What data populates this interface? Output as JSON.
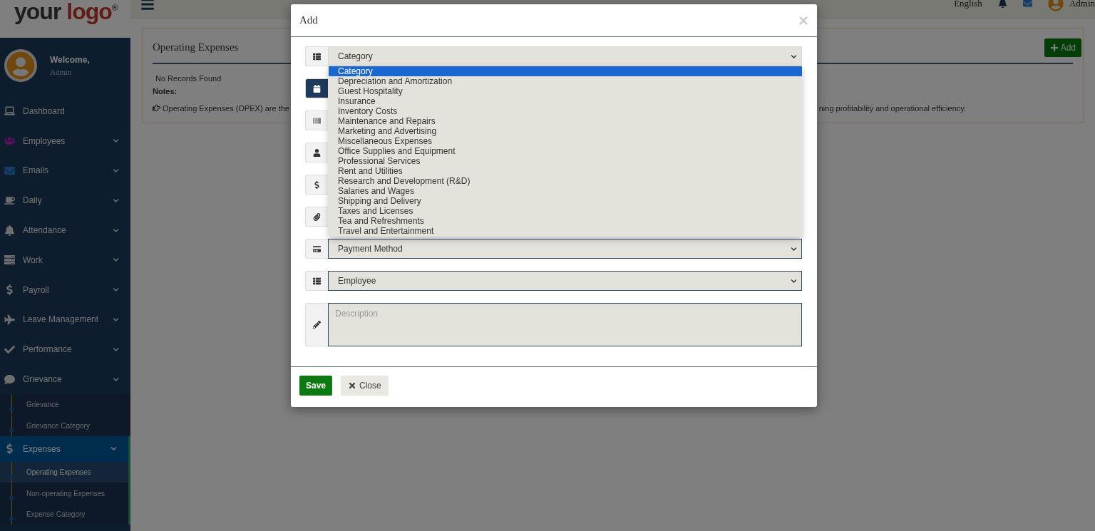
{
  "logo": {
    "word1": "your",
    "word2": "logo",
    "mark": "®"
  },
  "topbar": {
    "language": "English",
    "user": "Admin"
  },
  "sidebar": {
    "welcome": "Welcome,",
    "role": "Admin",
    "items": [
      {
        "label": "Dashboard",
        "expandable": false,
        "selected": false
      },
      {
        "label": "Employees",
        "expandable": true,
        "selected": false
      },
      {
        "label": "Emails",
        "expandable": true,
        "selected": false
      },
      {
        "label": "Daily",
        "expandable": true,
        "selected": false
      },
      {
        "label": "Attendance",
        "expandable": true,
        "selected": false
      },
      {
        "label": "Work",
        "expandable": true,
        "selected": false
      },
      {
        "label": "Payroll",
        "expandable": true,
        "selected": false
      },
      {
        "label": "Leave Management",
        "expandable": true,
        "selected": false
      },
      {
        "label": "Performance",
        "expandable": true,
        "selected": false
      },
      {
        "label": "Grievance",
        "expandable": true,
        "selected": false,
        "children": [
          {
            "label": "Grievance",
            "selected": false
          },
          {
            "label": "Grievance Category",
            "selected": false
          }
        ]
      },
      {
        "label": "Expenses",
        "expandable": true,
        "selected": true,
        "children": [
          {
            "label": "Operating Expenses",
            "selected": true
          },
          {
            "label": "Non-operating Expenses",
            "selected": false
          },
          {
            "label": "Expense Category",
            "selected": false
          }
        ]
      }
    ]
  },
  "page": {
    "title": "Operating Expenses",
    "add_button": "Add",
    "empty": "No Records Found",
    "notes_label": "Notes:",
    "note_start": "Operating Expenses (OPEX) are the",
    "note_end": "ning profitability and operational efficiency."
  },
  "modal": {
    "title": "Add",
    "close": "×",
    "fields": [
      {
        "kind": "select",
        "value": "Category",
        "focused": false
      },
      {
        "kind": "covered",
        "focused": true
      },
      {
        "kind": "covered",
        "focused": false
      },
      {
        "kind": "covered",
        "focused": false
      },
      {
        "kind": "covered",
        "focused": false
      },
      {
        "kind": "covered",
        "focused": false
      },
      {
        "kind": "select",
        "value": "Payment Method",
        "focused": false
      },
      {
        "kind": "select",
        "value": "Employee",
        "focused": false
      },
      {
        "kind": "textarea",
        "placeholder": "Description",
        "focused": false
      }
    ],
    "dropdown": {
      "options": [
        {
          "label": "Category",
          "selected": true
        },
        {
          "label": "Depreciation and Amortization",
          "selected": false
        },
        {
          "label": "Guest Hospitality",
          "selected": false
        },
        {
          "label": "Insurance",
          "selected": false
        },
        {
          "label": "Inventory Costs",
          "selected": false
        },
        {
          "label": "Maintenance and Repairs",
          "selected": false
        },
        {
          "label": "Marketing and Advertising",
          "selected": false
        },
        {
          "label": "Miscellaneous Expenses",
          "selected": false
        },
        {
          "label": "Office Supplies and Equipment",
          "selected": false
        },
        {
          "label": "Professional Services",
          "selected": false
        },
        {
          "label": "Rent and Utilities",
          "selected": false
        },
        {
          "label": "Research and Development (R&D)",
          "selected": false
        },
        {
          "label": "Salaries and Wages",
          "selected": false
        },
        {
          "label": "Shipping and Delivery",
          "selected": false
        },
        {
          "label": "Taxes and Licenses",
          "selected": false
        },
        {
          "label": "Tea and Refreshments",
          "selected": false
        },
        {
          "label": "Travel and Entertainment",
          "selected": false
        }
      ]
    },
    "save": "Save",
    "close_button": "Close"
  }
}
